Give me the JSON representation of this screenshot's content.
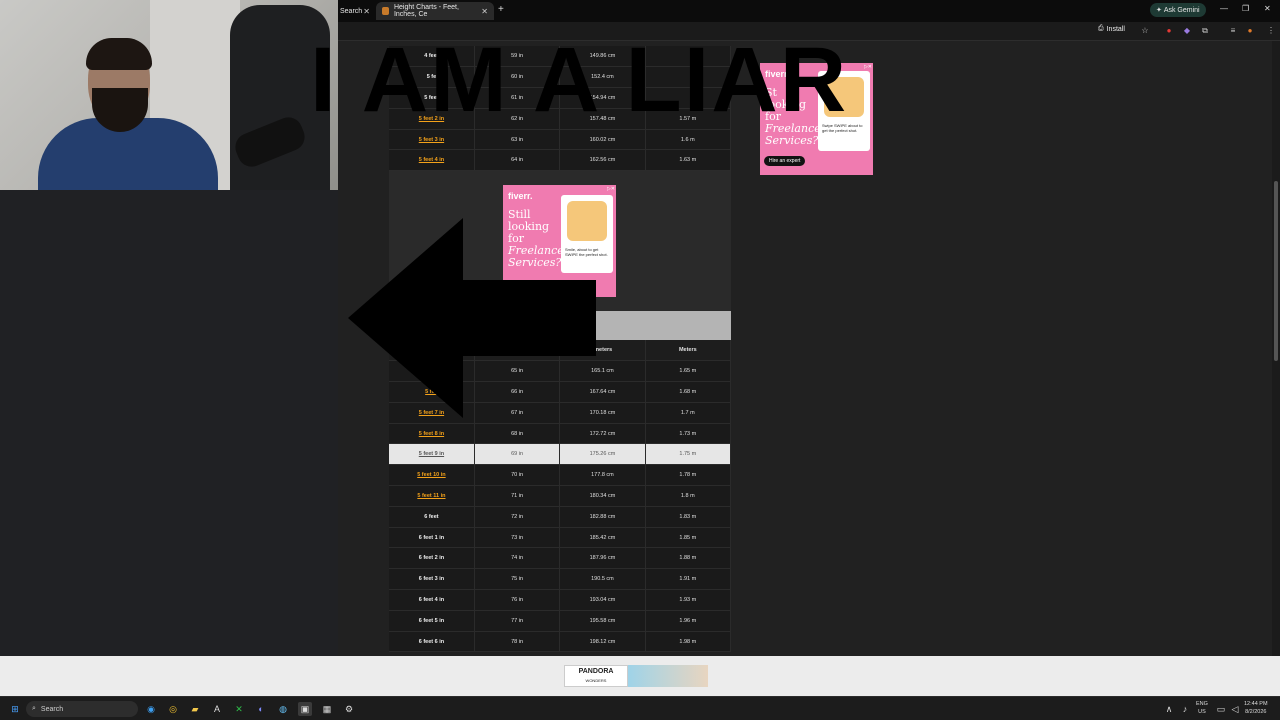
{
  "browser": {
    "tab_search": "Search",
    "tab_active": "Height Charts - Feet, Inches, Ce",
    "ask_gemini": "Ask Gemini",
    "install": "Install"
  },
  "table_top": {
    "rows": [
      [
        "4 feet",
        "59 in",
        "149.86 cm",
        ""
      ],
      [
        "5 fe",
        "60 in",
        "152.4 cm",
        ""
      ],
      [
        "5 feet",
        "61 in",
        "154.94 cm",
        ""
      ],
      [
        "5 feet 2 in",
        "62 in",
        "157.48 cm",
        "1.57 m"
      ],
      [
        "5 feet 3 in",
        "63 in",
        "160.02 cm",
        "1.6 m"
      ],
      [
        "5 feet 4 in",
        "64 in",
        "162.56 cm",
        "1.63 m"
      ]
    ]
  },
  "table_bottom": {
    "headers": [
      "",
      "",
      "imeters",
      "Meters"
    ],
    "rows": [
      [
        "",
        "65 in",
        "165.1 cm",
        "1.65 m"
      ],
      [
        "5 fee",
        "66 in",
        "167.64 cm",
        "1.68 m"
      ],
      [
        "5 feet 7 in",
        "67 in",
        "170.18 cm",
        "1.7 m"
      ],
      [
        "5 feet 8 in",
        "68 in",
        "172.72 cm",
        "1.73 m"
      ],
      [
        "5 feet 9 in",
        "69 in",
        "175.26 cm",
        "1.75 m"
      ],
      [
        "5 feet 10 in",
        "70 in",
        "177.8 cm",
        "1.78 m"
      ],
      [
        "5 feet 11 in",
        "71 in",
        "180.34 cm",
        "1.8 m"
      ],
      [
        "6 feet",
        "72 in",
        "182.88 cm",
        "1.83 m"
      ],
      [
        "6 feet 1 in",
        "73 in",
        "185.42 cm",
        "1.85 m"
      ],
      [
        "6 feet 2 in",
        "74 in",
        "187.96 cm",
        "1.88 m"
      ],
      [
        "6 feet 3 in",
        "75 in",
        "190.5 cm",
        "1.91 m"
      ],
      [
        "6 feet 4 in",
        "76 in",
        "193.04 cm",
        "1.93 m"
      ],
      [
        "6 feet 5 in",
        "77 in",
        "195.58 cm",
        "1.96 m"
      ],
      [
        "6 feet 6 in",
        "78 in",
        "198.12 cm",
        "1.98 m"
      ]
    ]
  },
  "ad_mid": {
    "brand": "fiverr.",
    "line1": "Still",
    "line2": "looking",
    "line3": "for",
    "line4": "Freelance",
    "line5": "Services?",
    "card_text": "Smile, about to get SWIPE the perfect shot.",
    "adx": "▷✕"
  },
  "ad_right": {
    "brand": "fiverr.",
    "line1": "St",
    "line2": "looking",
    "line3": "for",
    "line4": "Freelance",
    "line5": "Services?",
    "card_text": "Swipe SWIPE about to get the perfect shot.",
    "cta": "Hire an expert",
    "adx": "▷✕"
  },
  "bottom_ad": {
    "brand": "PANDORA",
    "sub": "WONDERS"
  },
  "taskbar": {
    "search": "Search",
    "lang1": "ENG",
    "lang2": "US",
    "time": "12:44 PM",
    "date": "8/2/2026"
  },
  "overlay": {
    "text": "I AM A LIAR"
  }
}
